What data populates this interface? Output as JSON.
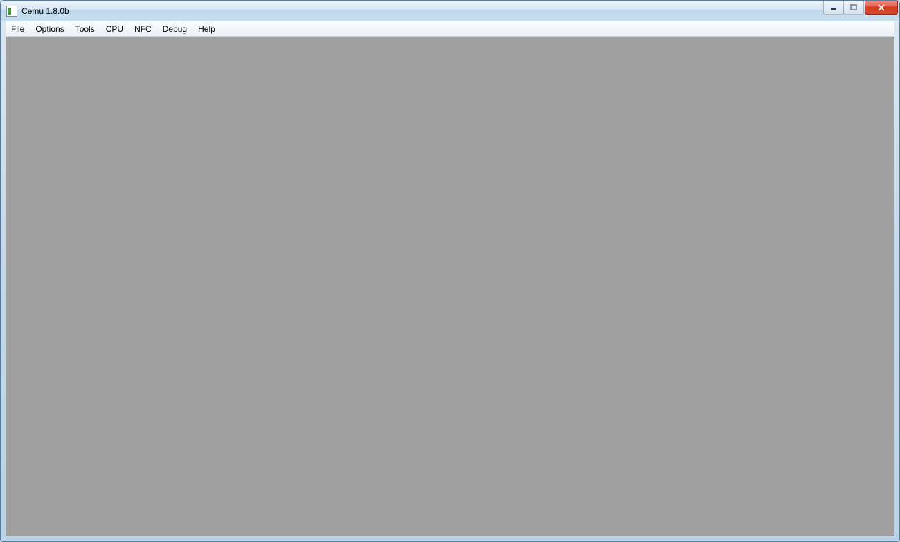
{
  "titlebar": {
    "title": "Cemu 1.8.0b"
  },
  "menubar": {
    "items": [
      {
        "label": "File"
      },
      {
        "label": "Options"
      },
      {
        "label": "Tools"
      },
      {
        "label": "CPU"
      },
      {
        "label": "NFC"
      },
      {
        "label": "Debug"
      },
      {
        "label": "Help"
      }
    ]
  }
}
